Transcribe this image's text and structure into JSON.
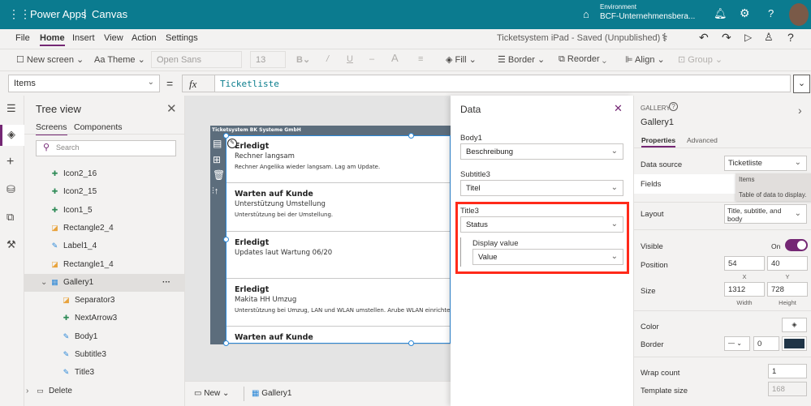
{
  "header": {
    "app_name": "Power Apps",
    "mode": "Canvas",
    "environment_label": "Environment",
    "environment_name": "BCF-Unternehmensbera..."
  },
  "menu": {
    "items": [
      "File",
      "Home",
      "Insert",
      "View",
      "Action",
      "Settings"
    ],
    "active": "Home",
    "doc_status": "Ticketsystem iPad - Saved (Unpublished)"
  },
  "toolbar": {
    "new_screen": "New screen",
    "theme": "Theme",
    "font": "Open Sans",
    "font_size": "13",
    "fill": "Fill",
    "border": "Border",
    "reorder": "Reorder",
    "align": "Align",
    "group": "Group"
  },
  "formula": {
    "property": "Items",
    "equals": "=",
    "fx": "fx",
    "value": "Ticketliste"
  },
  "tree": {
    "title": "Tree view",
    "tabs": [
      "Screens",
      "Components"
    ],
    "search_placeholder": "Search",
    "items": [
      {
        "label": "Icon2_16",
        "icon": "icon-control"
      },
      {
        "label": "Icon2_15",
        "icon": "icon-control"
      },
      {
        "label": "Icon1_5",
        "icon": "icon-control"
      },
      {
        "label": "Rectangle2_4",
        "icon": "shape"
      },
      {
        "label": "Label1_4",
        "icon": "label"
      },
      {
        "label": "Rectangle1_4",
        "icon": "shape"
      },
      {
        "label": "Gallery1",
        "icon": "gallery",
        "selected": true,
        "more": "···"
      },
      {
        "label": "Separator3",
        "icon": "shape",
        "child": true
      },
      {
        "label": "NextArrow3",
        "icon": "icon-control",
        "child": true
      },
      {
        "label": "Body1",
        "icon": "label",
        "child": true
      },
      {
        "label": "Subtitle3",
        "icon": "label",
        "child": true
      },
      {
        "label": "Title3",
        "icon": "label",
        "child": true
      },
      {
        "label": "Delete",
        "icon": "screen",
        "screen": true
      }
    ]
  },
  "app": {
    "header": "Ticketsystem BK Systeme GmbH",
    "rows": [
      {
        "title": "Erledigt",
        "subtitle": "Rechner langsam",
        "body": "Rechner Angelika wieder langsam. Lag am Update."
      },
      {
        "title": "Warten auf Kunde",
        "subtitle": "Unterstützung Umstellung",
        "body": "Unterstützung bei der Umstellung."
      },
      {
        "title": "Erledigt",
        "subtitle": "Updates laut Wartung 06/20",
        "body": ""
      },
      {
        "title": "Erledigt",
        "subtitle": "Makita HH Umzug",
        "body": "Unterstützung bei Umzug, LAN und WLAN umstellen. Arube WLAN einrichten"
      },
      {
        "title": "Warten auf Kunde",
        "subtitle": "",
        "body": ""
      }
    ]
  },
  "bottom": {
    "new": "New",
    "gallery": "Gallery1"
  },
  "data_pane": {
    "title": "Data",
    "fields": [
      {
        "label": "Body1",
        "value": "Beschreibung"
      },
      {
        "label": "Subtitle3",
        "value": "Titel"
      },
      {
        "label": "Title3",
        "value": "Status",
        "display_label": "Display value",
        "display_value": "Value"
      }
    ],
    "highlight_color": "#ff2a1a"
  },
  "props": {
    "type": "GALLERY",
    "name": "Gallery1",
    "tabs": [
      "Properties",
      "Advanced"
    ],
    "data_source_label": "Data source",
    "data_source": "Ticketliste",
    "fields_label": "Fields",
    "tooltip_title": "Items",
    "tooltip_text": "Table of data to display.",
    "layout_label": "Layout",
    "layout": "Title, subtitle, and body",
    "visible_label": "Visible",
    "visible": "On",
    "position_label": "Position",
    "x": "54",
    "y": "40",
    "x_label": "X",
    "y_label": "Y",
    "size_label": "Size",
    "width": "1312",
    "height": "728",
    "width_label": "Width",
    "height_label": "Height",
    "color_label": "Color",
    "border_label": "Border",
    "border_width": "0",
    "border_color": "#1f3447",
    "wrap_label": "Wrap count",
    "wrap": "1",
    "template_label": "Template size",
    "template": "168"
  },
  "colors": {
    "header": "#0b7b8f",
    "accent": "#742774",
    "app_dark": "#5c6d7c"
  }
}
